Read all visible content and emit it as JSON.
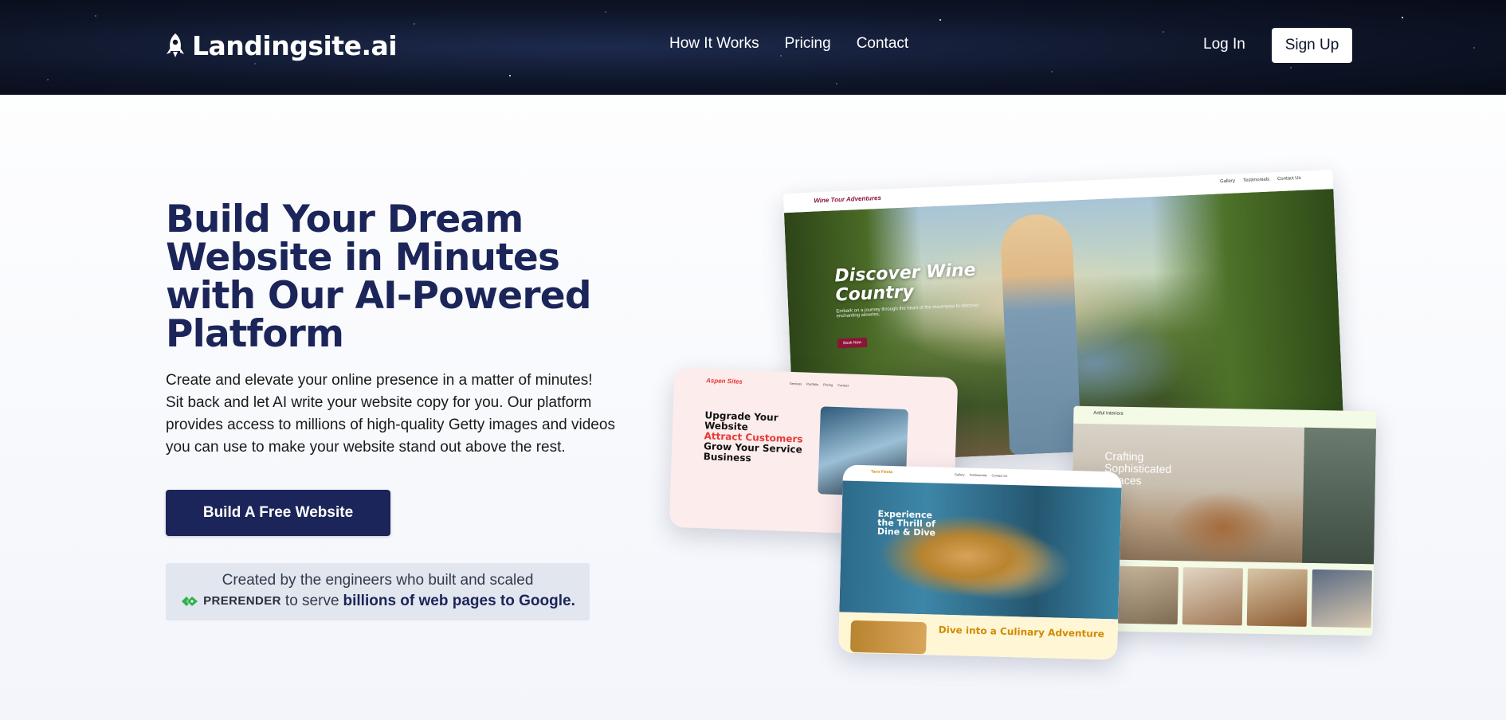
{
  "header": {
    "logo_text": "Landingsite.ai",
    "nav": [
      {
        "label": "How It Works"
      },
      {
        "label": "Pricing"
      },
      {
        "label": "Contact"
      }
    ],
    "login_label": "Log In",
    "signup_label": "Sign Up"
  },
  "hero": {
    "title": "Build Your Dream Website in Minutes with Our AI-Powered Platform",
    "description_lines": [
      "Create and elevate your online presence in a matter of minutes!",
      "Sit back and let AI write your website copy for you. Our platform",
      "provides access to millions of high-quality Getty images and videos",
      "you can use to make your website stand out above the rest."
    ],
    "cta_label": "Build A Free Website",
    "credit": {
      "line1": "Created by the engineers who built and scaled",
      "brand": "PRERENDER",
      "middle": "to serve",
      "strong": "billions of web pages to Google."
    }
  },
  "mockups": {
    "wine": {
      "brand": "Wine Tour Adventures",
      "menu": [
        "Gallery",
        "Testimonials",
        "Contact Us"
      ],
      "headline": "Discover Wine Country",
      "sub": "Embark on a journey through the heart of the mountains to discover enchanting wineries.",
      "button": "Book Now"
    },
    "aspen": {
      "brand": "Aspen Sites",
      "menu": [
        "Services",
        "Portfolio",
        "Pricing",
        "Contact"
      ],
      "headline_1": "Upgrade Your Website",
      "headline_2": "Attract Customers",
      "headline_3": "Grow Your Service Business"
    },
    "interior": {
      "brand": "Artful Interiors",
      "title": "Crafting Sophisticated Spaces"
    },
    "taco": {
      "brand": "Taco Fiesta",
      "menu": [
        "Gallery",
        "Testimonials",
        "Contact Us"
      ],
      "headline": "Experience the Thrill of Dine & Dive",
      "sub": "Dive into a Culinary Adventure"
    }
  },
  "colors": {
    "brand_navy": "#1b2559",
    "nav_bg": "#0e1528",
    "credit_bg": "#e2e6ee",
    "prerender_green": "#2fb34a"
  }
}
